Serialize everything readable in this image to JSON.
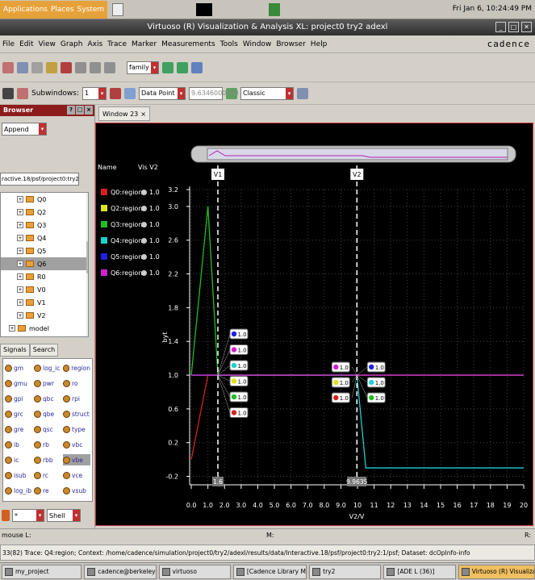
{
  "topbar": {
    "menus": [
      "Applications",
      "Places",
      "System"
    ],
    "clock": "Fri Jan  6, 10:24:49 PM"
  },
  "window": {
    "title": "Virtuoso (R) Visualization & Analysis XL: project0 try2 adexl",
    "brand": "cadence"
  },
  "menubar": [
    "File",
    "Edit",
    "View",
    "Graph",
    "Axis",
    "Trace",
    "Marker",
    "Measurements",
    "Tools",
    "Window",
    "Browser",
    "Help"
  ],
  "toolbar": {
    "family_combo": "family",
    "subwindows_label": "Subwindows:",
    "subwindows_value": "1",
    "marker_combo": "Data Point",
    "marker_value": "9.6346000000",
    "style_combo": "Classic"
  },
  "tabs": {
    "window_tab": "Window 23"
  },
  "browser": {
    "title": "Browser",
    "mode": "Append",
    "path": "ractive.18/psf/project0:try2:1/psf",
    "tree_items": [
      "Q0",
      "Q2",
      "Q3",
      "Q4",
      "Q5",
      "Q6",
      "R0",
      "V0",
      "V1",
      "V2",
      "model"
    ],
    "selected_tree_item": "Q6",
    "tabs": [
      "Signals",
      "Search"
    ],
    "signals_col1": [
      "gm",
      "gmu",
      "gpi",
      "grc",
      "gre",
      "ib",
      "ic",
      "isub",
      "log_ib"
    ],
    "signals_col2": [
      "log_ic",
      "pwr",
      "qbc",
      "qbe",
      "qsc",
      "rb",
      "rbb",
      "rc",
      "re"
    ],
    "signals_col3": [
      "region",
      "ro",
      "rpi",
      "struct",
      "type",
      "vbc",
      "vbe",
      "vce",
      "vsub"
    ],
    "selected_signal": "vbe",
    "filter": "*",
    "shell": "Shell"
  },
  "plot": {
    "legend_header_name": "Name",
    "legend_header_vis": "Vis V2",
    "legend": [
      {
        "name": "Q0:region",
        "vis": "1.0",
        "color": "#d62020"
      },
      {
        "name": "Q2:region",
        "vis": "1.0",
        "color": "#e0e020"
      },
      {
        "name": "Q3:region",
        "vis": "1.0",
        "color": "#20c020"
      },
      {
        "name": "Q4:region",
        "vis": "1.0",
        "color": "#20d0d0"
      },
      {
        "name": "Q5:region",
        "vis": "1.0",
        "color": "#2020e0"
      },
      {
        "name": "Q6:region",
        "vis": "1.0",
        "color": "#d020d0"
      }
    ],
    "markers": [
      {
        "label": "V1",
        "x": 1.6,
        "readout": "1.6"
      },
      {
        "label": "V2",
        "x": 9.9635,
        "readout": "9.9635"
      }
    ],
    "badge_values": [
      "1.0",
      "1.0",
      "1.0",
      "1.0",
      "1.0",
      "1.0"
    ]
  },
  "chart_data": {
    "type": "line",
    "xlabel": "V2/V",
    "ylabel": "byt",
    "xlim": [
      -0.1,
      20.0
    ],
    "ylim": [
      -0.3,
      3.2
    ],
    "xticks": [
      "0.0",
      "1.0",
      "2.0",
      "3.0",
      "4.0",
      "5.0",
      "6.0",
      "7.0",
      "8.0",
      "9.0",
      "10",
      "11",
      "12",
      "13",
      "14",
      "15",
      "16",
      "17",
      "18",
      "19",
      "20"
    ],
    "yticks": [
      "-0.2",
      "0.2",
      "0.6",
      "1.0",
      "1.4",
      "1.8",
      "2.2",
      "2.6",
      "3.0",
      "3.2"
    ],
    "series": [
      {
        "name": "Q0:region",
        "color": "#d62020",
        "x": [
          0.0,
          0.6,
          1.0,
          20.0
        ],
        "y": [
          0.0,
          0.6,
          1.0,
          1.0
        ]
      },
      {
        "name": "Q3:region",
        "color": "#20c020",
        "x": [
          0.0,
          1.0,
          1.6,
          20.0
        ],
        "y": [
          1.0,
          3.0,
          1.0,
          1.0
        ]
      },
      {
        "name": "Q4:region",
        "color": "#20d0d0",
        "x": [
          0.0,
          9.9635,
          10.5,
          20.0
        ],
        "y": [
          1.0,
          1.0,
          -0.1,
          -0.1
        ]
      },
      {
        "name": "Q6:region",
        "color": "#d020d0",
        "x": [
          0.0,
          20.0
        ],
        "y": [
          1.0,
          1.0
        ]
      }
    ]
  }
}
